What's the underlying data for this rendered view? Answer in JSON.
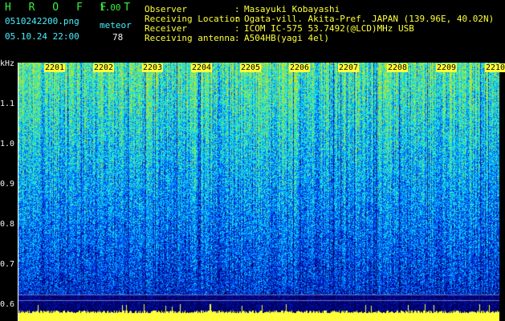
{
  "app": {
    "title": "H R O F F T",
    "version": "1.00",
    "mode": "meteor"
  },
  "file": {
    "name": "0510242200.png",
    "datetime": "05.10.24 22:00",
    "count": "78"
  },
  "info": [
    {
      "label": "Observer",
      "value": "Masayuki Kobayashi"
    },
    {
      "label": "Receiving Location",
      "value": "Ogata-vill. Akita-Pref. JAPAN (139.96E, 40.02N)"
    },
    {
      "label": "Receiver",
      "value": "ICOM IC-575 53.7492(@LCD)MHz USB"
    },
    {
      "label": "Receiving antenna",
      "value": "A504HB(yagi 4el)"
    }
  ],
  "info_sep": ":",
  "axis": {
    "unit": "kHz",
    "y_ticks": [
      "1.1",
      "1.0",
      "0.9",
      "0.8",
      "0.7",
      "0.6"
    ],
    "x_ticks": [
      "2201",
      "2202",
      "2203",
      "2204",
      "2205",
      "2206",
      "2207",
      "2208",
      "2209",
      "2210"
    ]
  },
  "colors": {
    "background": "#000000",
    "header_title": "#3cf03c",
    "header_info": "#ffff3a",
    "minute_marker_bg": "#ffff3a",
    "spectrogram_low": "#0a1ea0",
    "spectrogram_mid": "#00c8ff",
    "spectrogram_high": "#a8ff50"
  }
}
